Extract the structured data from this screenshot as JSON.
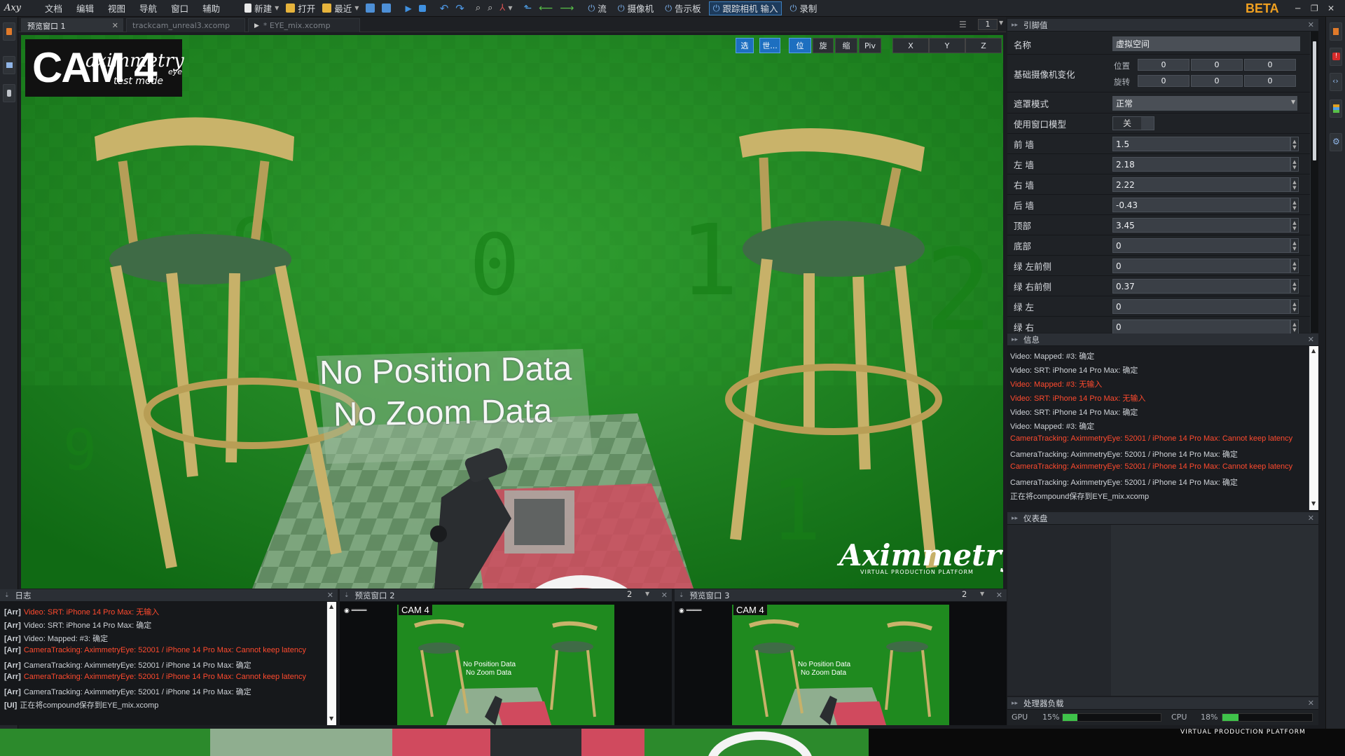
{
  "app": {
    "logo": "Axy",
    "beta": "BETA"
  },
  "menu": [
    "文档",
    "编辑",
    "视图",
    "导航",
    "窗口",
    "辅助"
  ],
  "toolbar": {
    "new_label": "新建",
    "open_label": "打开",
    "recent_label": "最近",
    "stream_label": "流",
    "camera_label": "摄像机",
    "prompter_label": "告示板",
    "tracking_label": "跟踪相机 输入",
    "record_label": "录制"
  },
  "tabs": [
    {
      "label": "预览窗口 1",
      "close": "✕"
    },
    {
      "label": "trackcam_unreal3.xcomp"
    },
    {
      "label": "* EYE_mix.xcomp"
    }
  ],
  "viewport": {
    "page_num": "1",
    "mode_buttons": [
      "选",
      "世...",
      "位",
      "旋",
      "缩",
      "Piv"
    ],
    "axis_buttons": [
      "X",
      "Y",
      "Z"
    ],
    "overlay_line1": "No Position Data",
    "overlay_line2": "No Zoom Data",
    "cam_logo_text": "CAM 4",
    "aximmetry_eye": "aximmetry",
    "eye_suffix": "eye",
    "test_mode": "test mode",
    "watermark": "Aximmetry",
    "watermark_sub": "VIRTUAL PRODUCTION PLATFORM"
  },
  "properties": {
    "title": "引脚值",
    "name_label": "名称",
    "name_value": "虚拟空间",
    "base_transform_label": "基础摄像机变化",
    "position_label": "位置",
    "rotation_label": "旋转",
    "position_values": [
      "0",
      "0",
      "0"
    ],
    "rotation_values": [
      "0",
      "0",
      "0"
    ],
    "mask_mode_label": "遮罩模式",
    "mask_mode_value": "正常",
    "use_window_label": "使用窗口模型",
    "use_window_value": "关",
    "rows": [
      {
        "label": "前 墙",
        "value": "1.5"
      },
      {
        "label": "左 墙",
        "value": "2.18"
      },
      {
        "label": "右 墙",
        "value": "2.22"
      },
      {
        "label": "后 墙",
        "value": "-0.43"
      },
      {
        "label": "顶部",
        "value": "3.45"
      },
      {
        "label": "底部",
        "value": "0"
      },
      {
        "label": "绿 左前侧",
        "value": "0"
      },
      {
        "label": "绿 右前侧",
        "value": "0.37"
      },
      {
        "label": "绿 左",
        "value": "0"
      },
      {
        "label": "绿 右",
        "value": "0"
      }
    ]
  },
  "info": {
    "title": "信息",
    "lines": [
      {
        "text": "Video: Mapped: #3: 确定",
        "red": false
      },
      {
        "text": "Video: SRT: iPhone 14 Pro Max: 确定",
        "red": false
      },
      {
        "text": "Video: Mapped: #3: 无输入",
        "red": true
      },
      {
        "text": "Video: SRT: iPhone 14 Pro Max: 无输入",
        "red": true
      },
      {
        "text": "Video: SRT: iPhone 14 Pro Max: 确定",
        "red": false
      },
      {
        "text": "Video: Mapped: #3: 确定",
        "red": false
      },
      {
        "text": "CameraTracking: AximmetryEye: 52001 / iPhone 14 Pro Max: Cannot keep latency",
        "red": true
      },
      {
        "text": "CameraTracking: AximmetryEye: 52001 / iPhone 14 Pro Max: 确定",
        "red": false
      },
      {
        "text": "CameraTracking: AximmetryEye: 52001 / iPhone 14 Pro Max: Cannot keep latency",
        "red": true
      },
      {
        "text": "CameraTracking: AximmetryEye: 52001 / iPhone 14 Pro Max: 确定",
        "red": false
      },
      {
        "text": "正在将compound保存到EYE_mix.xcomp",
        "red": false
      }
    ]
  },
  "dashboard": {
    "title": "仪表盘"
  },
  "processor": {
    "title": "处理器负载",
    "gpu_label": "GPU",
    "gpu_value": "15%",
    "gpu_fraction": 0.15,
    "cpu_label": "CPU",
    "cpu_value": "18%",
    "cpu_fraction": 0.18
  },
  "log": {
    "title": "日志",
    "lines": [
      {
        "tag": "[Arr]",
        "text": "Video: SRT: iPhone 14 Pro Max: 无输入",
        "red": true
      },
      {
        "tag": "[Arr]",
        "text": "Video: SRT: iPhone 14 Pro Max: 确定",
        "red": false
      },
      {
        "tag": "[Arr]",
        "text": "Video: Mapped: #3: 确定",
        "red": false
      },
      {
        "tag": "[Arr]",
        "text": "CameraTracking: AximmetryEye: 52001 / iPhone 14 Pro Max: Cannot keep latency",
        "red": true
      },
      {
        "tag": "[Arr]",
        "text": "CameraTracking: AximmetryEye: 52001 / iPhone 14 Pro Max: 确定",
        "red": false
      },
      {
        "tag": "[Arr]",
        "text": "CameraTracking: AximmetryEye: 52001 / iPhone 14 Pro Max: Cannot keep latency",
        "red": true
      },
      {
        "tag": "[Arr]",
        "text": "CameraTracking: AximmetryEye: 52001 / iPhone 14 Pro Max: 确定",
        "red": false
      },
      {
        "tag": "[UI]",
        "text": "正在将compound保存到EYE_mix.xcomp",
        "red": false
      }
    ]
  },
  "preview2": {
    "title": "预览窗口 2",
    "num": "2",
    "cam": "CAM 4",
    "l1": "No Position Data",
    "l2": "No Zoom Data"
  },
  "preview3": {
    "title": "预览窗口 3",
    "num": "2",
    "cam": "CAM 4",
    "l1": "No Position Data",
    "l2": "No Zoom Data"
  },
  "footer": {
    "text": "VIRTUAL PRODUCTION PLATFORM"
  }
}
